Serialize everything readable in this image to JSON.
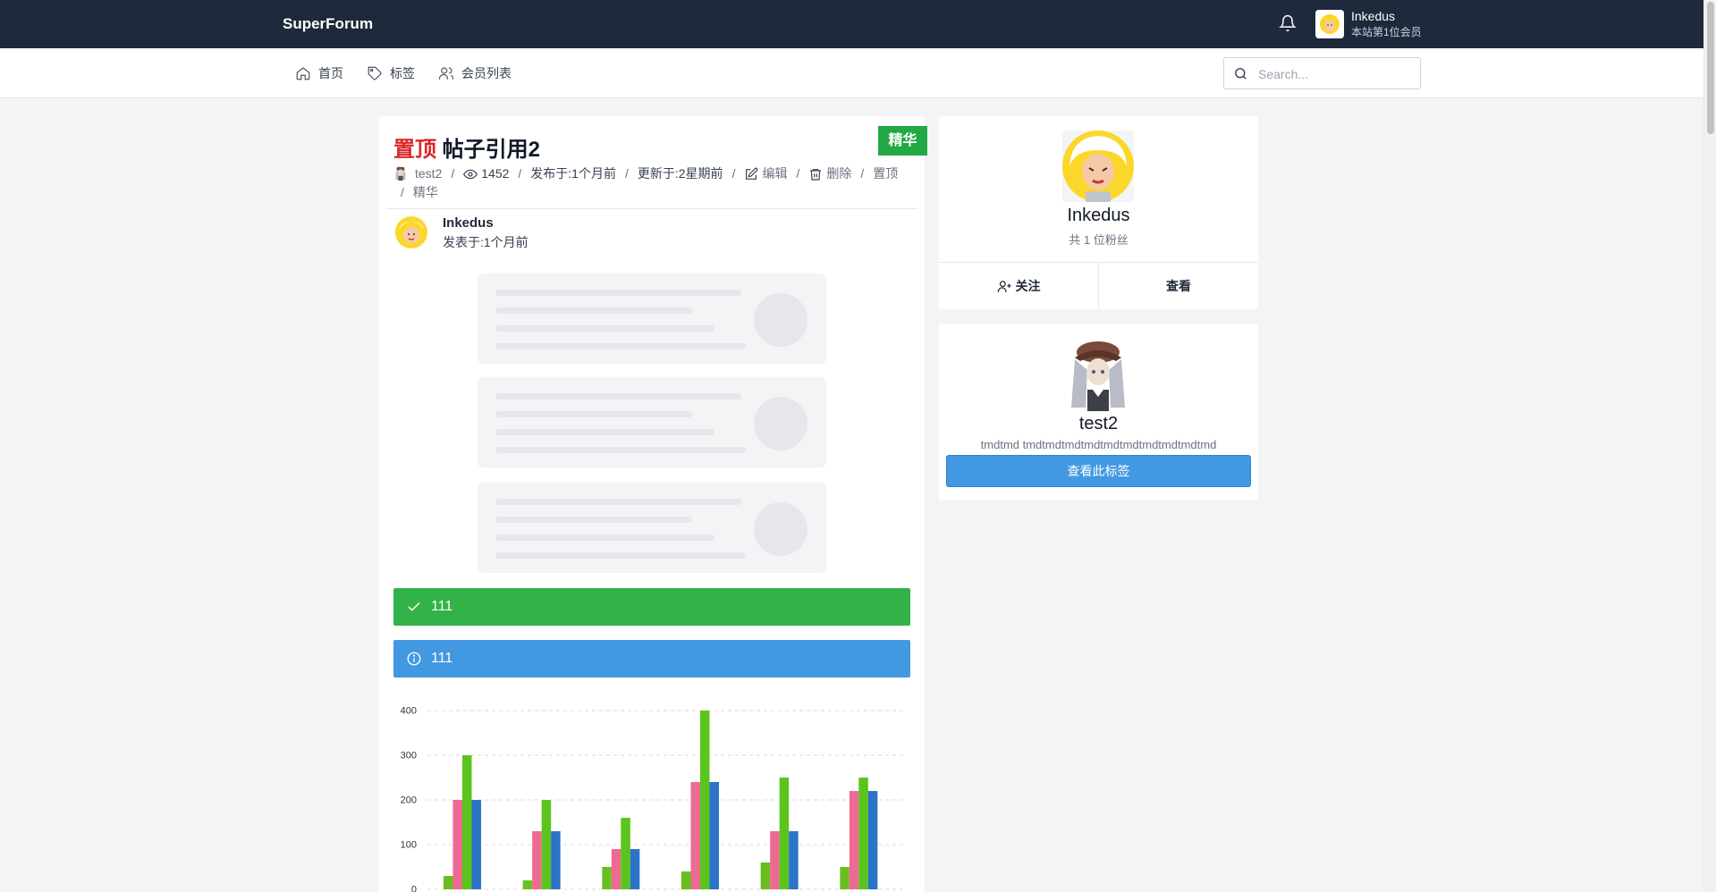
{
  "topbar": {
    "brand": "SuperForum",
    "user_name": "Inkedus",
    "user_sub": "本站第1位会员"
  },
  "nav": {
    "home": "首页",
    "tags": "标签",
    "members": "会员列表"
  },
  "search": {
    "placeholder": "Search..."
  },
  "post": {
    "pin_label": "置顶",
    "title": "帖子引用2",
    "badge": "精华",
    "author_tag": "test2",
    "views": "1452",
    "published": "发布于:1个月前",
    "updated": "更新于:2星期前",
    "edit": "编辑",
    "delete": "删除",
    "pin_action": "置顶",
    "essence_action": "精华",
    "author": "Inkedus",
    "author_time": "发表于:1个月前"
  },
  "alerts": {
    "success": "111",
    "info": "111"
  },
  "profile": {
    "name": "Inkedus",
    "fans": "共 1 位粉丝",
    "follow": "关注",
    "view": "查看"
  },
  "tag": {
    "name": "test2",
    "desc": "tmdtmd tmdtmdtmdtmdtmdtmdtmdtmdtmdtmd",
    "button": "查看此标签"
  },
  "colors": {
    "topbar": "#1e293b",
    "green": "#33b24a",
    "blue": "#4299e1",
    "red": "#dc2626"
  },
  "chart_data": {
    "type": "bar",
    "yticks": [
      "0",
      "100",
      "200",
      "300",
      "400"
    ],
    "ylim": [
      0,
      400
    ],
    "grid": true,
    "categories": [
      "",
      "",
      "",
      "",
      "",
      ""
    ],
    "series": [
      {
        "values": [
          30,
          20,
          50,
          40,
          60,
          50
        ],
        "color": "#6abf1f"
      },
      {
        "values": [
          200,
          130,
          90,
          240,
          130,
          220
        ],
        "color": "#ed6a92"
      },
      {
        "values": [
          300,
          200,
          160,
          400,
          250,
          250
        ],
        "color": "#5bc41d"
      },
      {
        "values": [
          200,
          130,
          90,
          240,
          130,
          220
        ],
        "color": "#2b74c8"
      }
    ]
  }
}
